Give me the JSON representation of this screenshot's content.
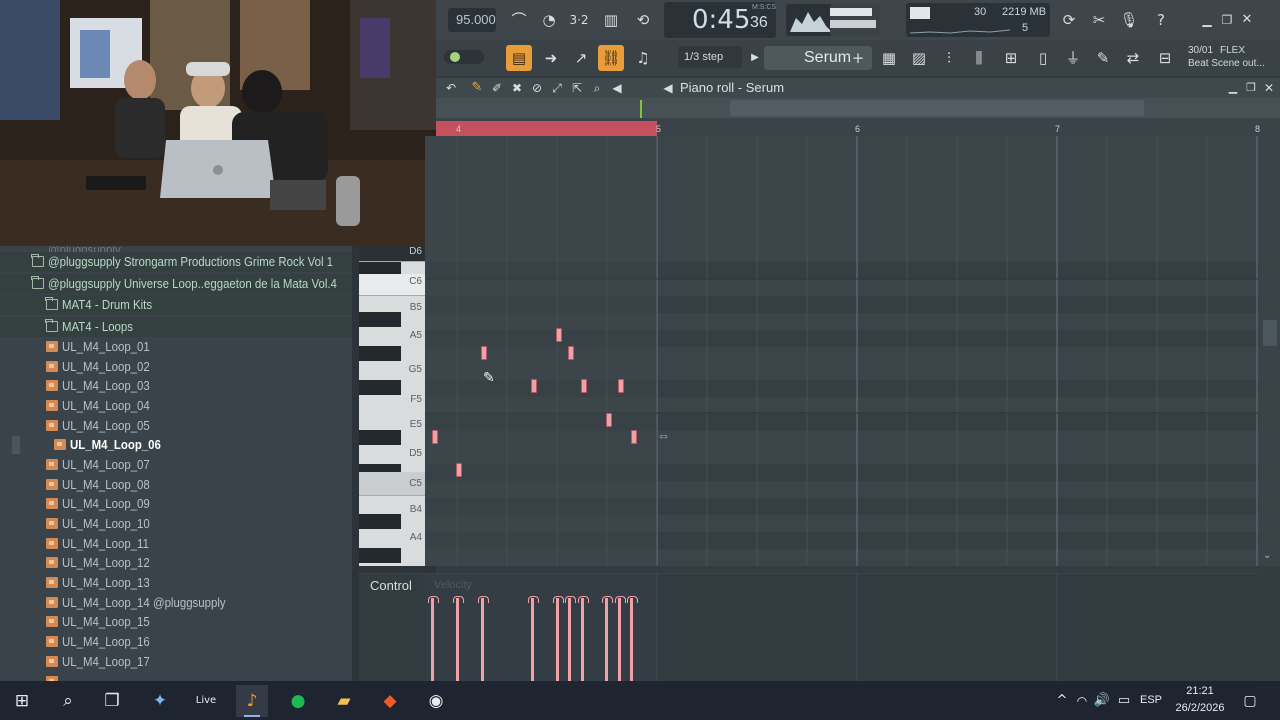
{
  "fl_studio": {
    "tempo": "95.000",
    "time_display": "0:45",
    "time_subdisplay": "36",
    "time_mode_label": "M:S:CS",
    "cpu": "30",
    "memory": "2219 MB",
    "polyphony": "5",
    "snap": "1/3 step",
    "channel_selector": "Serum",
    "news_date": "30/01",
    "news_title": "FLEX",
    "news_subtitle": "Beat Scene out..."
  },
  "piano_roll": {
    "title": "Piano roll - Serum",
    "bars": [
      "4",
      "5",
      "6",
      "7",
      "8"
    ],
    "key_labels": [
      "D6",
      "C6",
      "B5",
      "A5",
      "G5",
      "F5",
      "E5",
      "D5",
      "C5",
      "B4",
      "A4"
    ],
    "control_label": "Control",
    "control_target": "Velocity"
  },
  "browser": {
    "packs": [
      "@pluggsupply Strongarm Productions Grime Rock Vol 1",
      "@pluggsupply Universe Loop..eggaeton de la Mata Vol.4"
    ],
    "folders": [
      "MAT4 - Drum Kits",
      "MAT4 - Loops"
    ],
    "files": [
      "UL_M4_Loop_01",
      "UL_M4_Loop_02",
      "UL_M4_Loop_03",
      "UL_M4_Loop_04",
      "UL_M4_Loop_05",
      "UL_M4_Loop_06",
      "UL_M4_Loop_07",
      "UL_M4_Loop_08",
      "UL_M4_Loop_09",
      "UL_M4_Loop_10",
      "UL_M4_Loop_11",
      "UL_M4_Loop_12",
      "UL_M4_Loop_13",
      "UL_M4_Loop_14 @pluggsupply",
      "UL_M4_Loop_15",
      "UL_M4_Loop_16",
      "UL_M4_Loop_17"
    ],
    "selected_file": "UL_M4_Loop_06"
  },
  "taskbar": {
    "language": "ESP",
    "time": "21:21",
    "date": "26/2/2026",
    "live_label": "Live"
  }
}
